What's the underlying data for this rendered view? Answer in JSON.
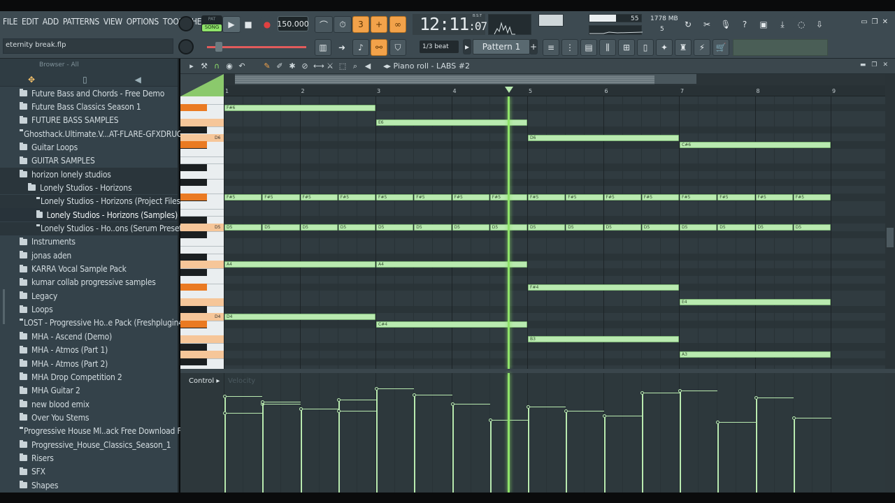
{
  "menu": [
    "FILE",
    "EDIT",
    "ADD",
    "PATTERNS",
    "VIEW",
    "OPTIONS",
    "TOOLS",
    "HELP"
  ],
  "project": {
    "filename": "eternity break.flp"
  },
  "transport": {
    "song_label": "SONG",
    "pat_label": "PAT",
    "tempo": "150.000",
    "clock_main": "12:11",
    "clock_sub": ":07",
    "clock_unit": "B:S:T"
  },
  "monitor": {
    "memory": "1778 MB",
    "cpu": "55",
    "voices": "5"
  },
  "snap": "1/3 beat",
  "pattern": "Pattern 1",
  "browser": {
    "label": "Browser - All",
    "items": [
      {
        "label": "Future Bass and Chords - Free Demo",
        "indent": 0,
        "state": ""
      },
      {
        "label": "Future Bass Classics Season 1",
        "indent": 0,
        "state": ""
      },
      {
        "label": "FUTURE BASS SAMPLES",
        "indent": 0,
        "state": ""
      },
      {
        "label": "Ghosthack.Ultimate.V...AT-FLARE-GFXDRUG.COM",
        "indent": 0,
        "state": ""
      },
      {
        "label": "Guitar Loops",
        "indent": 0,
        "state": ""
      },
      {
        "label": "GUITAR SAMPLES",
        "indent": 0,
        "state": ""
      },
      {
        "label": "horizon lonely studios",
        "indent": 0,
        "state": "sel"
      },
      {
        "label": "Lonely Studios - Horizons",
        "indent": 1,
        "state": "sel"
      },
      {
        "label": "Lonely Studios - Horizons (Project Files)",
        "indent": 2,
        "state": "sel"
      },
      {
        "label": "Lonely Studios - Horizons (Samples)",
        "indent": 2,
        "state": "sel2"
      },
      {
        "label": "Lonely Studios - Ho..ons (Serum Presets)",
        "indent": 2,
        "state": "sel"
      },
      {
        "label": "Instruments",
        "indent": 0,
        "state": ""
      },
      {
        "label": "jonas aden",
        "indent": 0,
        "state": ""
      },
      {
        "label": "KARRA Vocal Sample Pack",
        "indent": 0,
        "state": ""
      },
      {
        "label": "kumar collab progressive samples",
        "indent": 0,
        "state": ""
      },
      {
        "label": "Legacy",
        "indent": 0,
        "state": ""
      },
      {
        "label": "Loops",
        "indent": 0,
        "state": ""
      },
      {
        "label": "LOST - Progressive Ho..e Pack (Freshplugin4u)",
        "indent": 0,
        "state": ""
      },
      {
        "label": "MHA - Ascend (Demo)",
        "indent": 0,
        "state": ""
      },
      {
        "label": "MHA - Atmos (Part 1)",
        "indent": 0,
        "state": ""
      },
      {
        "label": "MHA - Atmos (Part 2)",
        "indent": 0,
        "state": ""
      },
      {
        "label": "MHA Drop Competition 2",
        "indent": 0,
        "state": ""
      },
      {
        "label": "MHA Guitar 2",
        "indent": 0,
        "state": ""
      },
      {
        "label": "new blood emix",
        "indent": 0,
        "state": ""
      },
      {
        "label": "Over You Stems",
        "indent": 0,
        "state": ""
      },
      {
        "label": "Progressive House Ml..ack Free Download Feb",
        "indent": 0,
        "state": ""
      },
      {
        "label": "Progressive_House_Classics_Season_1",
        "indent": 0,
        "state": ""
      },
      {
        "label": "Risers",
        "indent": 0,
        "state": ""
      },
      {
        "label": "SFX",
        "indent": 0,
        "state": ""
      },
      {
        "label": "Shapes",
        "indent": 0,
        "state": ""
      }
    ]
  },
  "piano_roll": {
    "title": "Piano roll - LABS #2",
    "bars": [
      "1",
      "2",
      "3",
      "4",
      "5",
      "6",
      "7",
      "8",
      "9"
    ],
    "key_labels": [
      "D6",
      "D5",
      "D4"
    ],
    "playhead_beat": 4.75,
    "notes": [
      {
        "label": "F#6",
        "row": 1,
        "start": 1,
        "len": 2
      },
      {
        "label": "E6",
        "row": 3,
        "start": 3,
        "len": 2
      },
      {
        "label": "D6",
        "row": 5,
        "start": 5,
        "len": 2
      },
      {
        "label": "C#6",
        "row": 6,
        "start": 7,
        "len": 2
      },
      {
        "label": "A4",
        "row": 22,
        "start": 1,
        "len": 2
      },
      {
        "label": "A4",
        "row": 22,
        "start": 3,
        "len": 2
      },
      {
        "label": "F#4",
        "row": 25,
        "start": 5,
        "len": 2
      },
      {
        "label": "E4",
        "row": 27,
        "start": 7,
        "len": 2
      },
      {
        "label": "D4",
        "row": 29,
        "start": 1,
        "len": 2
      },
      {
        "label": "C#4",
        "row": 30,
        "start": 3,
        "len": 2
      },
      {
        "label": "B3",
        "row": 32,
        "start": 5,
        "len": 2
      },
      {
        "label": "A3",
        "row": 34,
        "start": 7,
        "len": 2
      }
    ],
    "repeat_notes": [
      {
        "label": "F#5",
        "row": 13,
        "from": 1,
        "to": 9,
        "step": 0.5
      },
      {
        "label": "D5",
        "row": 17,
        "from": 1,
        "to": 9,
        "step": 0.5
      }
    ],
    "control_label": "Control",
    "control_sub": "Velocity",
    "velocities": [
      0.85,
      0.78,
      0.74,
      0.82,
      0.92,
      0.86,
      0.78,
      0.64,
      0.76,
      0.72,
      0.68,
      0.88,
      0.9,
      0.62,
      0.84,
      0.66,
      0.7,
      0.8,
      0.74,
      0.72
    ]
  }
}
